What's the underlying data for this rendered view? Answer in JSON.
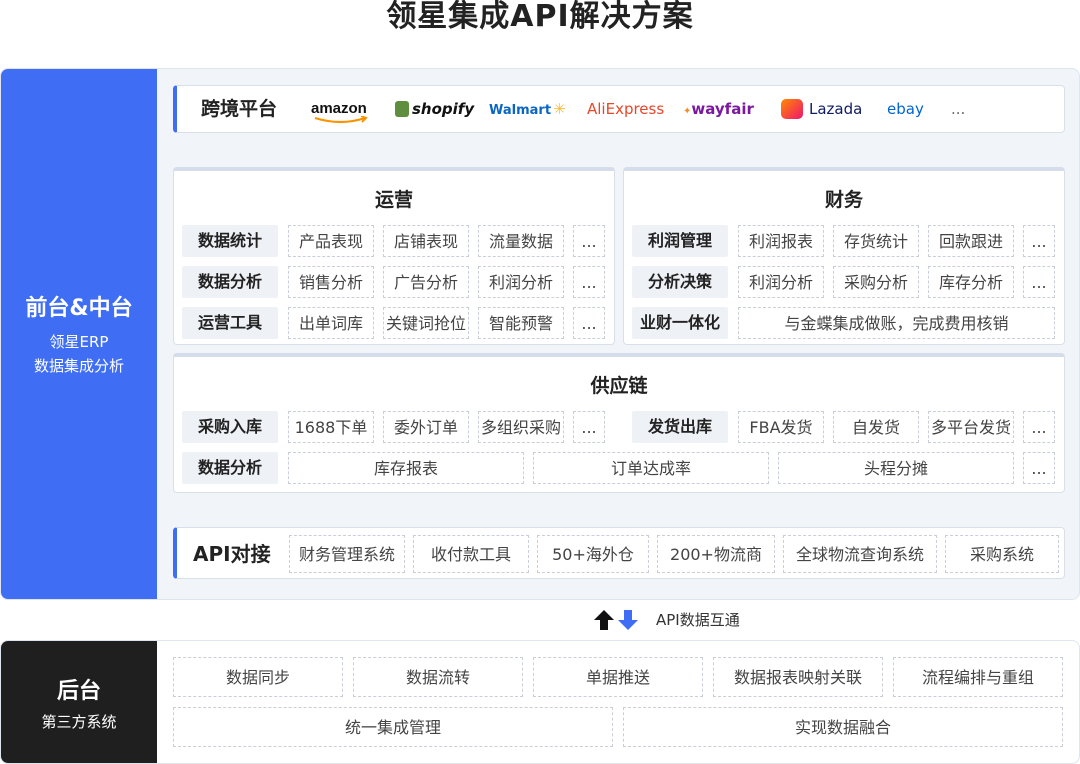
{
  "title": "领星集成API解决方案",
  "front": {
    "side_title": "前台&中台",
    "side_sub1": "领星ERP",
    "side_sub2": "数据集成分析",
    "platforms": {
      "title": "跨境平台",
      "logos": [
        "amazon",
        "shopify",
        "Walmart",
        "AliExpress",
        "wayfair",
        "Lazada",
        "ebay",
        "..."
      ]
    },
    "operations": {
      "title": "运营",
      "rows": [
        {
          "label": "数据统计",
          "cells": [
            "产品表现",
            "店铺表现",
            "流量数据",
            "..."
          ]
        },
        {
          "label": "数据分析",
          "cells": [
            "销售分析",
            "广告分析",
            "利润分析",
            "..."
          ]
        },
        {
          "label": "运营工具",
          "cells": [
            "出单词库",
            "关键词抢位",
            "智能预警",
            "..."
          ]
        }
      ]
    },
    "finance": {
      "title": "财务",
      "rows": [
        {
          "label": "利润管理",
          "cells": [
            "利润报表",
            "存货统计",
            "回款跟进",
            "..."
          ]
        },
        {
          "label": "分析决策",
          "cells": [
            "利润分析",
            "采购分析",
            "库存分析",
            "..."
          ]
        },
        {
          "label": "业财一体化",
          "cells": [
            "与金蝶集成做账，完成费用核销"
          ]
        }
      ]
    },
    "supply": {
      "title": "供应链",
      "row1_left": {
        "label": "采购入库",
        "cells": [
          "1688下单",
          "委外订单",
          "多组织采购",
          "..."
        ]
      },
      "row1_right": {
        "label": "发货出库",
        "cells": [
          "FBA发货",
          "自发货",
          "多平台发货",
          "..."
        ]
      },
      "row2": {
        "label": "数据分析",
        "cells": [
          "库存报表",
          "订单达成率",
          "头程分摊",
          "..."
        ]
      }
    },
    "api": {
      "title": "API对接",
      "cells": [
        "财务管理系统",
        "收付款工具",
        "50+海外仓",
        "200+物流商",
        "全球物流查询系统",
        "采购系统"
      ]
    }
  },
  "link_label": "API数据互通",
  "back": {
    "side_title": "后台",
    "side_sub": "第三方系统",
    "row1": [
      "数据同步",
      "数据流转",
      "单据推送",
      "数据报表映射关联",
      "流程编排与重组"
    ],
    "row2": [
      "统一集成管理",
      "实现数据融合"
    ]
  },
  "colors": {
    "accent": "#3f6ef4",
    "dark": "#1f1f1f",
    "panel_bg": "#f1f4f9"
  }
}
